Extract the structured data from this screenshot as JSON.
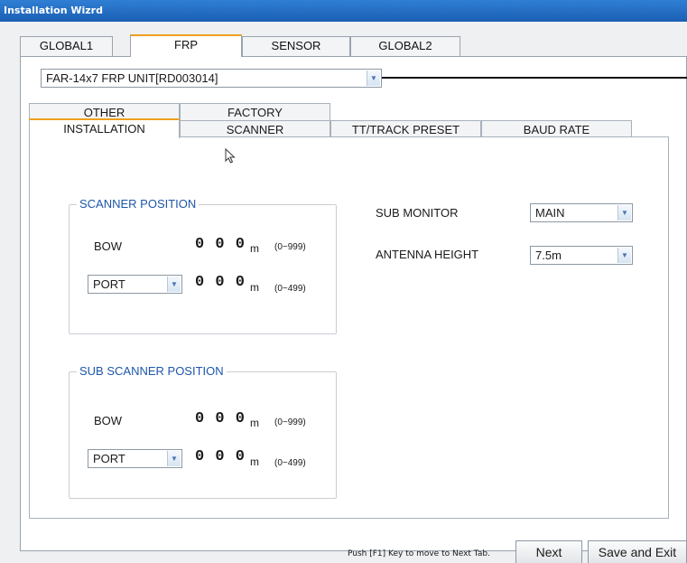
{
  "window": {
    "title": "Installation Wizrd"
  },
  "top_tabs": [
    "GLOBAL1",
    "FRP",
    "SENSOR",
    "GLOBAL2"
  ],
  "unit_selector": {
    "value": "FAR-14x7 FRP UNIT[RD003014]",
    "icon": "chevron-down-icon"
  },
  "sub_tabs": {
    "back_row": [
      "OTHER",
      "FACTORY"
    ],
    "front_row": [
      "INSTALLATION",
      "SCANNER",
      "TT/TRACK PRESET",
      "BAUD RATE"
    ],
    "active": "INSTALLATION"
  },
  "scanner_position": {
    "title": "SCANNER POSITION",
    "bow_label": "BOW",
    "bow_value": "0 0 0",
    "bow_unit": "m",
    "bow_range": "(0~999)",
    "side_select": "PORT",
    "side_value": "0 0 0",
    "side_unit": "m",
    "side_range": "(0~499)"
  },
  "sub_scanner_position": {
    "title": "SUB SCANNER POSITION",
    "bow_label": "BOW",
    "bow_value": "0 0 0",
    "bow_unit": "m",
    "bow_range": "(0~999)",
    "side_select": "PORT",
    "side_value": "0 0 0",
    "side_unit": "m",
    "side_range": "(0~499)"
  },
  "settings": {
    "sub_monitor_label": "SUB MONITOR",
    "sub_monitor_value": "MAIN",
    "antenna_height_label": "ANTENNA HEIGHT",
    "antenna_height_value": "7.5m"
  },
  "footer": {
    "hint": "Push [F1] Key to move to Next Tab.",
    "next_label": "Next",
    "save_exit_label": "Save and Exit"
  },
  "colors": {
    "accent_tab": "#f0a020",
    "group_title": "#1e56a8",
    "titlebar": "#1b5fb3"
  }
}
